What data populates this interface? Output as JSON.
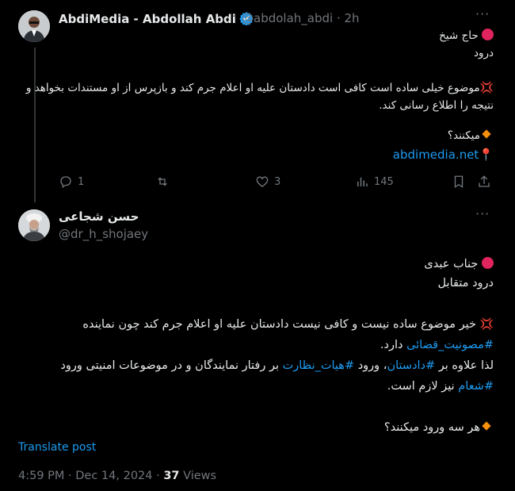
{
  "tweet1": {
    "display_name": "AbdiMedia - Abdollah Abdi",
    "handle": "@abdolah_abdi",
    "time": "· 2h",
    "salutation": "حاج شیخ",
    "greeting": "درود",
    "body_line1": "موضوع خیلی ساده است کافی است دادستان علیه او اعلام جرم کند و بازپرس از او مستندات بخواهد و",
    "body_line2": "نتیجه را اطلاع رسانی کند.",
    "question": "میکنند؟",
    "link": "abdimedia.net",
    "stats": {
      "replies": "1",
      "retweets": "",
      "likes": "3",
      "views": "145"
    }
  },
  "tweet2": {
    "display_name": "حسن شجاعی",
    "handle": "@dr_h_shojaey",
    "salutation": "جناب عبدی",
    "greeting": "درود متقابل",
    "para1_line1": "خیر موضوع ساده نیست و کافی نیست دادستان علیه او اعلام جرم کند چون نماینده",
    "hashtag1": "#مصونیت_قضائی",
    "para1_line2_rest": " دارد.",
    "para2_prefix": "لذا علاوه بر ",
    "hashtag2": "#دادستان",
    "para2_mid1": "، ورود ",
    "hashtag3": "#هیات_نظارت",
    "para2_mid2": " بر رفتار نمایندگان و در موضوعات امنیتی ورود",
    "hashtag4": "#شعام",
    "para2_end": " نیز لازم است.",
    "question": "هر سه ورود میکنند؟",
    "translate": "Translate post",
    "timestamp": "4:59 PM · Dec 14, 2024 · ",
    "views_count": "37",
    "views_label": " Views"
  },
  "colors": {
    "background": "#000000",
    "text": "#e7e9ea",
    "muted": "#71767b",
    "link": "#1d9bf0",
    "verified": "#1d9bf0"
  }
}
